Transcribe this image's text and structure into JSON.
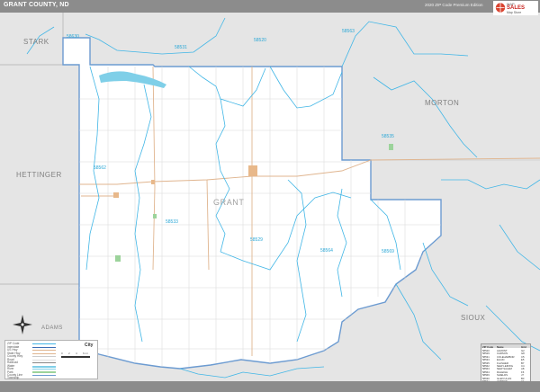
{
  "header": {
    "title": "GRANT COUNTY, ND",
    "edition": "2020 ZIP Code Premium Edition"
  },
  "logo": {
    "line1": "MAP",
    "line2": "SALES",
    "line3": "Map Store"
  },
  "counties": {
    "stark": "STARK",
    "morton": "MORTON",
    "hettinger": "HETTINGER",
    "sioux": "SIOUX",
    "adams": "ADAMS",
    "grant": "GRANT"
  },
  "zip_labels": {
    "z58630": "58630",
    "z58531": "58531",
    "z58520": "58520",
    "z58563": "58563",
    "z58535": "58535",
    "z58562": "58562",
    "z58533": "58533",
    "z58529": "58529",
    "z58564": "58564",
    "z58569": "58569"
  },
  "legend": {
    "city_label": "City",
    "rows": [
      "ZIP Code",
      "Interstate",
      "US Hwy",
      "State Hwy",
      "County Hwy",
      "Road",
      "Railroad",
      "Water",
      "River",
      "Park",
      "County Line",
      "Township"
    ],
    "scale": [
      "0",
      "2",
      "4",
      "6 mi"
    ]
  },
  "zip_table": {
    "headers": [
      "ZIP Code",
      "Name",
      "Grid"
    ],
    "rows": [
      [
        "58520",
        "ALMONT",
        "G2"
      ],
      [
        "58529",
        "CARSON",
        "G8"
      ],
      [
        "58531",
        "COLEHARBOR",
        "C5"
      ],
      [
        "58533",
        "ELGIN",
        "E5"
      ],
      [
        "58535",
        "FLASHER",
        "B7"
      ],
      [
        "58562",
        "NEW LEIPZIG",
        "C4"
      ],
      [
        "58563",
        "NEW SALEM",
        "A8"
      ],
      [
        "58564",
        "RALEIGH",
        "F6"
      ],
      [
        "58569",
        "SHIELDS",
        "J7"
      ],
      [
        "58630",
        "GLEN ULLIN",
        "B3"
      ],
      [
        "58531",
        "HEBRON",
        "C1"
      ]
    ]
  },
  "colors": {
    "county_fill": "#ffffff",
    "outside_fill": "#e5e5e5",
    "zip_boundary": "#41b6e6",
    "roads": "#cccccc",
    "highways": "#e3b48a",
    "county_border": "#6699cc"
  }
}
